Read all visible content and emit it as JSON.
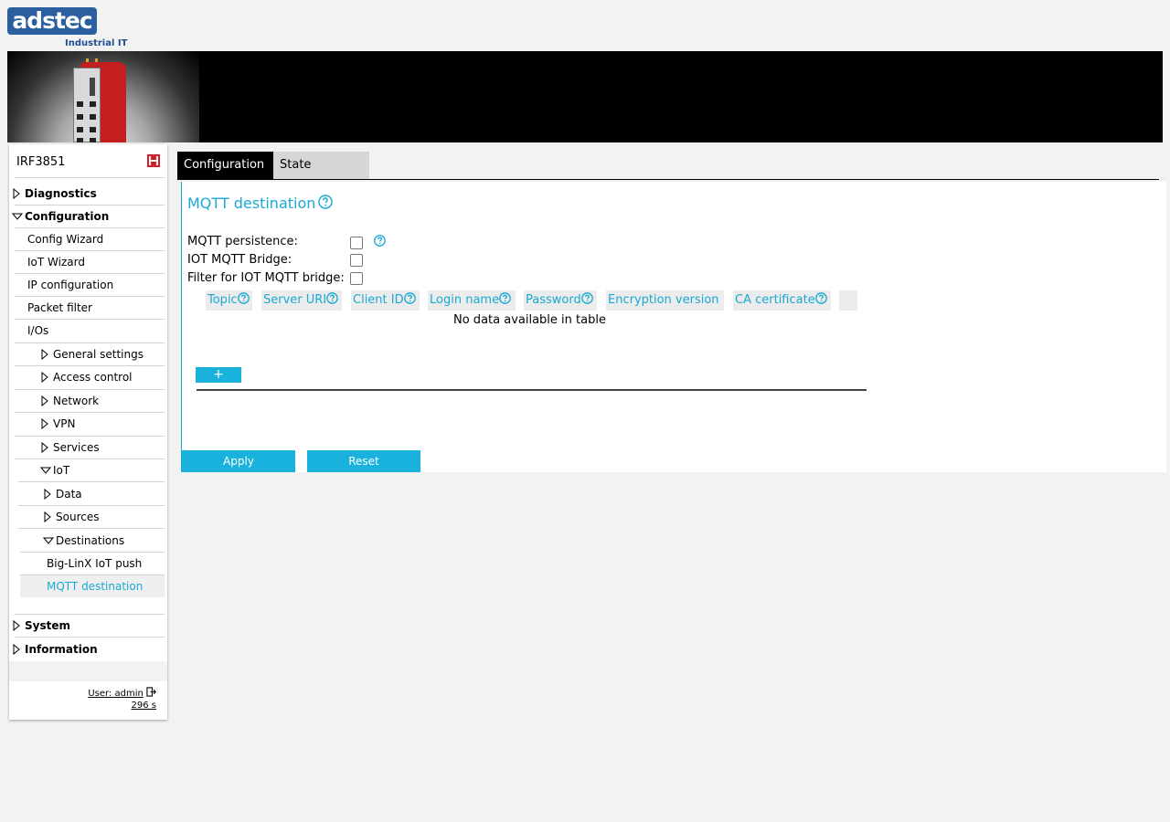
{
  "brand": {
    "logo_text": "adstec",
    "subtitle": "Industrial IT"
  },
  "colors": {
    "accent": "#19a9d3",
    "button": "#19b2dc",
    "logo_blue": "#2b5fa0",
    "device_red": "#c51e1e",
    "save_icon": "#d42027"
  },
  "sidebar": {
    "device_name": "IRF3851",
    "save_icon": "save-icon",
    "top_items": [
      {
        "label": "Diagnostics",
        "expanded": false
      },
      {
        "label": "Configuration",
        "expanded": true
      },
      {
        "label": "System",
        "expanded": false
      },
      {
        "label": "Information",
        "expanded": false
      }
    ],
    "config_items": [
      "Config Wizard",
      "IoT Wizard",
      "IP configuration",
      "Packet filter",
      "I/Os"
    ],
    "config_groups": [
      "General settings",
      "Access control",
      "Network",
      "VPN",
      "Services",
      "IoT"
    ],
    "iot_groups": [
      "Data",
      "Sources",
      "Destinations"
    ],
    "destinations": [
      "Big-LinX IoT push",
      "MQTT destination"
    ],
    "active_item": "MQTT destination",
    "user": "User: admin",
    "session": "296 s"
  },
  "tabs": [
    {
      "label": "Configuration",
      "active": true
    },
    {
      "label": "State",
      "active": false
    }
  ],
  "main": {
    "title": "MQTT destination",
    "fields": [
      {
        "label": "MQTT persistence:",
        "checked": false,
        "has_help": true
      },
      {
        "label": "IOT MQTT Bridge:",
        "checked": false,
        "has_help": false
      },
      {
        "label": "Filter for IOT MQTT bridge:",
        "checked": false,
        "has_help": false
      }
    ],
    "table": {
      "columns": [
        "Topic",
        "Server URI",
        "Client ID",
        "Login name",
        "Password",
        "Encryption version",
        "CA certificate"
      ],
      "empty_message": "No data available in table",
      "add_label": "+"
    },
    "apply_label": "Apply",
    "reset_label": "Reset"
  }
}
